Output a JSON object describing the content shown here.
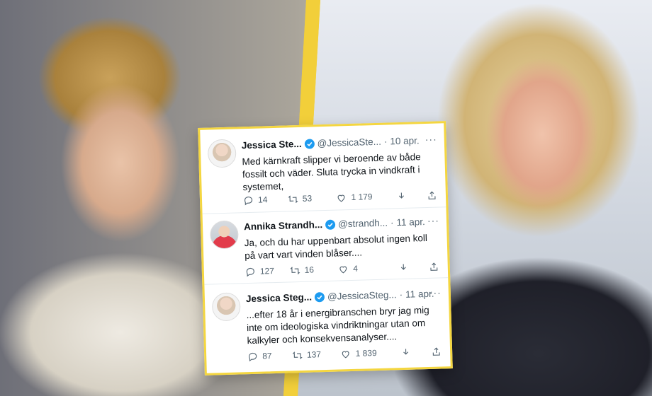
{
  "tweets": [
    {
      "name": "Jessica Ste...",
      "handle": "@JessicaSte...",
      "date": "10 apr.",
      "text": "Med kärnkraft slipper vi beroende av både fossilt och väder. Sluta trycka in vindkraft i systemet,",
      "replies": "14",
      "retweets": "53",
      "likes": "1 179"
    },
    {
      "name": "Annika Strandh...",
      "handle": "@strandh...",
      "date": "11 apr.",
      "text": "Ja, och du har uppenbart absolut ingen koll på vart vart vinden blåser....",
      "replies": "127",
      "retweets": "16",
      "likes": "4"
    },
    {
      "name": "Jessica Steg...",
      "handle": "@JessicaSteg...",
      "date": "11 apr.",
      "text": "...efter 18 år i energibranschen bryr jag mig inte om ideologiska vindriktningar utan om kalkyler och konsekvensanalyser....",
      "replies": "87",
      "retweets": "137",
      "likes": "1 839"
    }
  ],
  "ui": {
    "separator": "·",
    "more": "···"
  },
  "colors": {
    "accent_yellow": "#f2cf3a",
    "verified_blue": "#1d9bf0",
    "meta_gray": "#536471"
  },
  "icons": [
    "verified-icon",
    "reply-icon",
    "retweet-icon",
    "like-icon",
    "download-icon",
    "share-icon"
  ]
}
